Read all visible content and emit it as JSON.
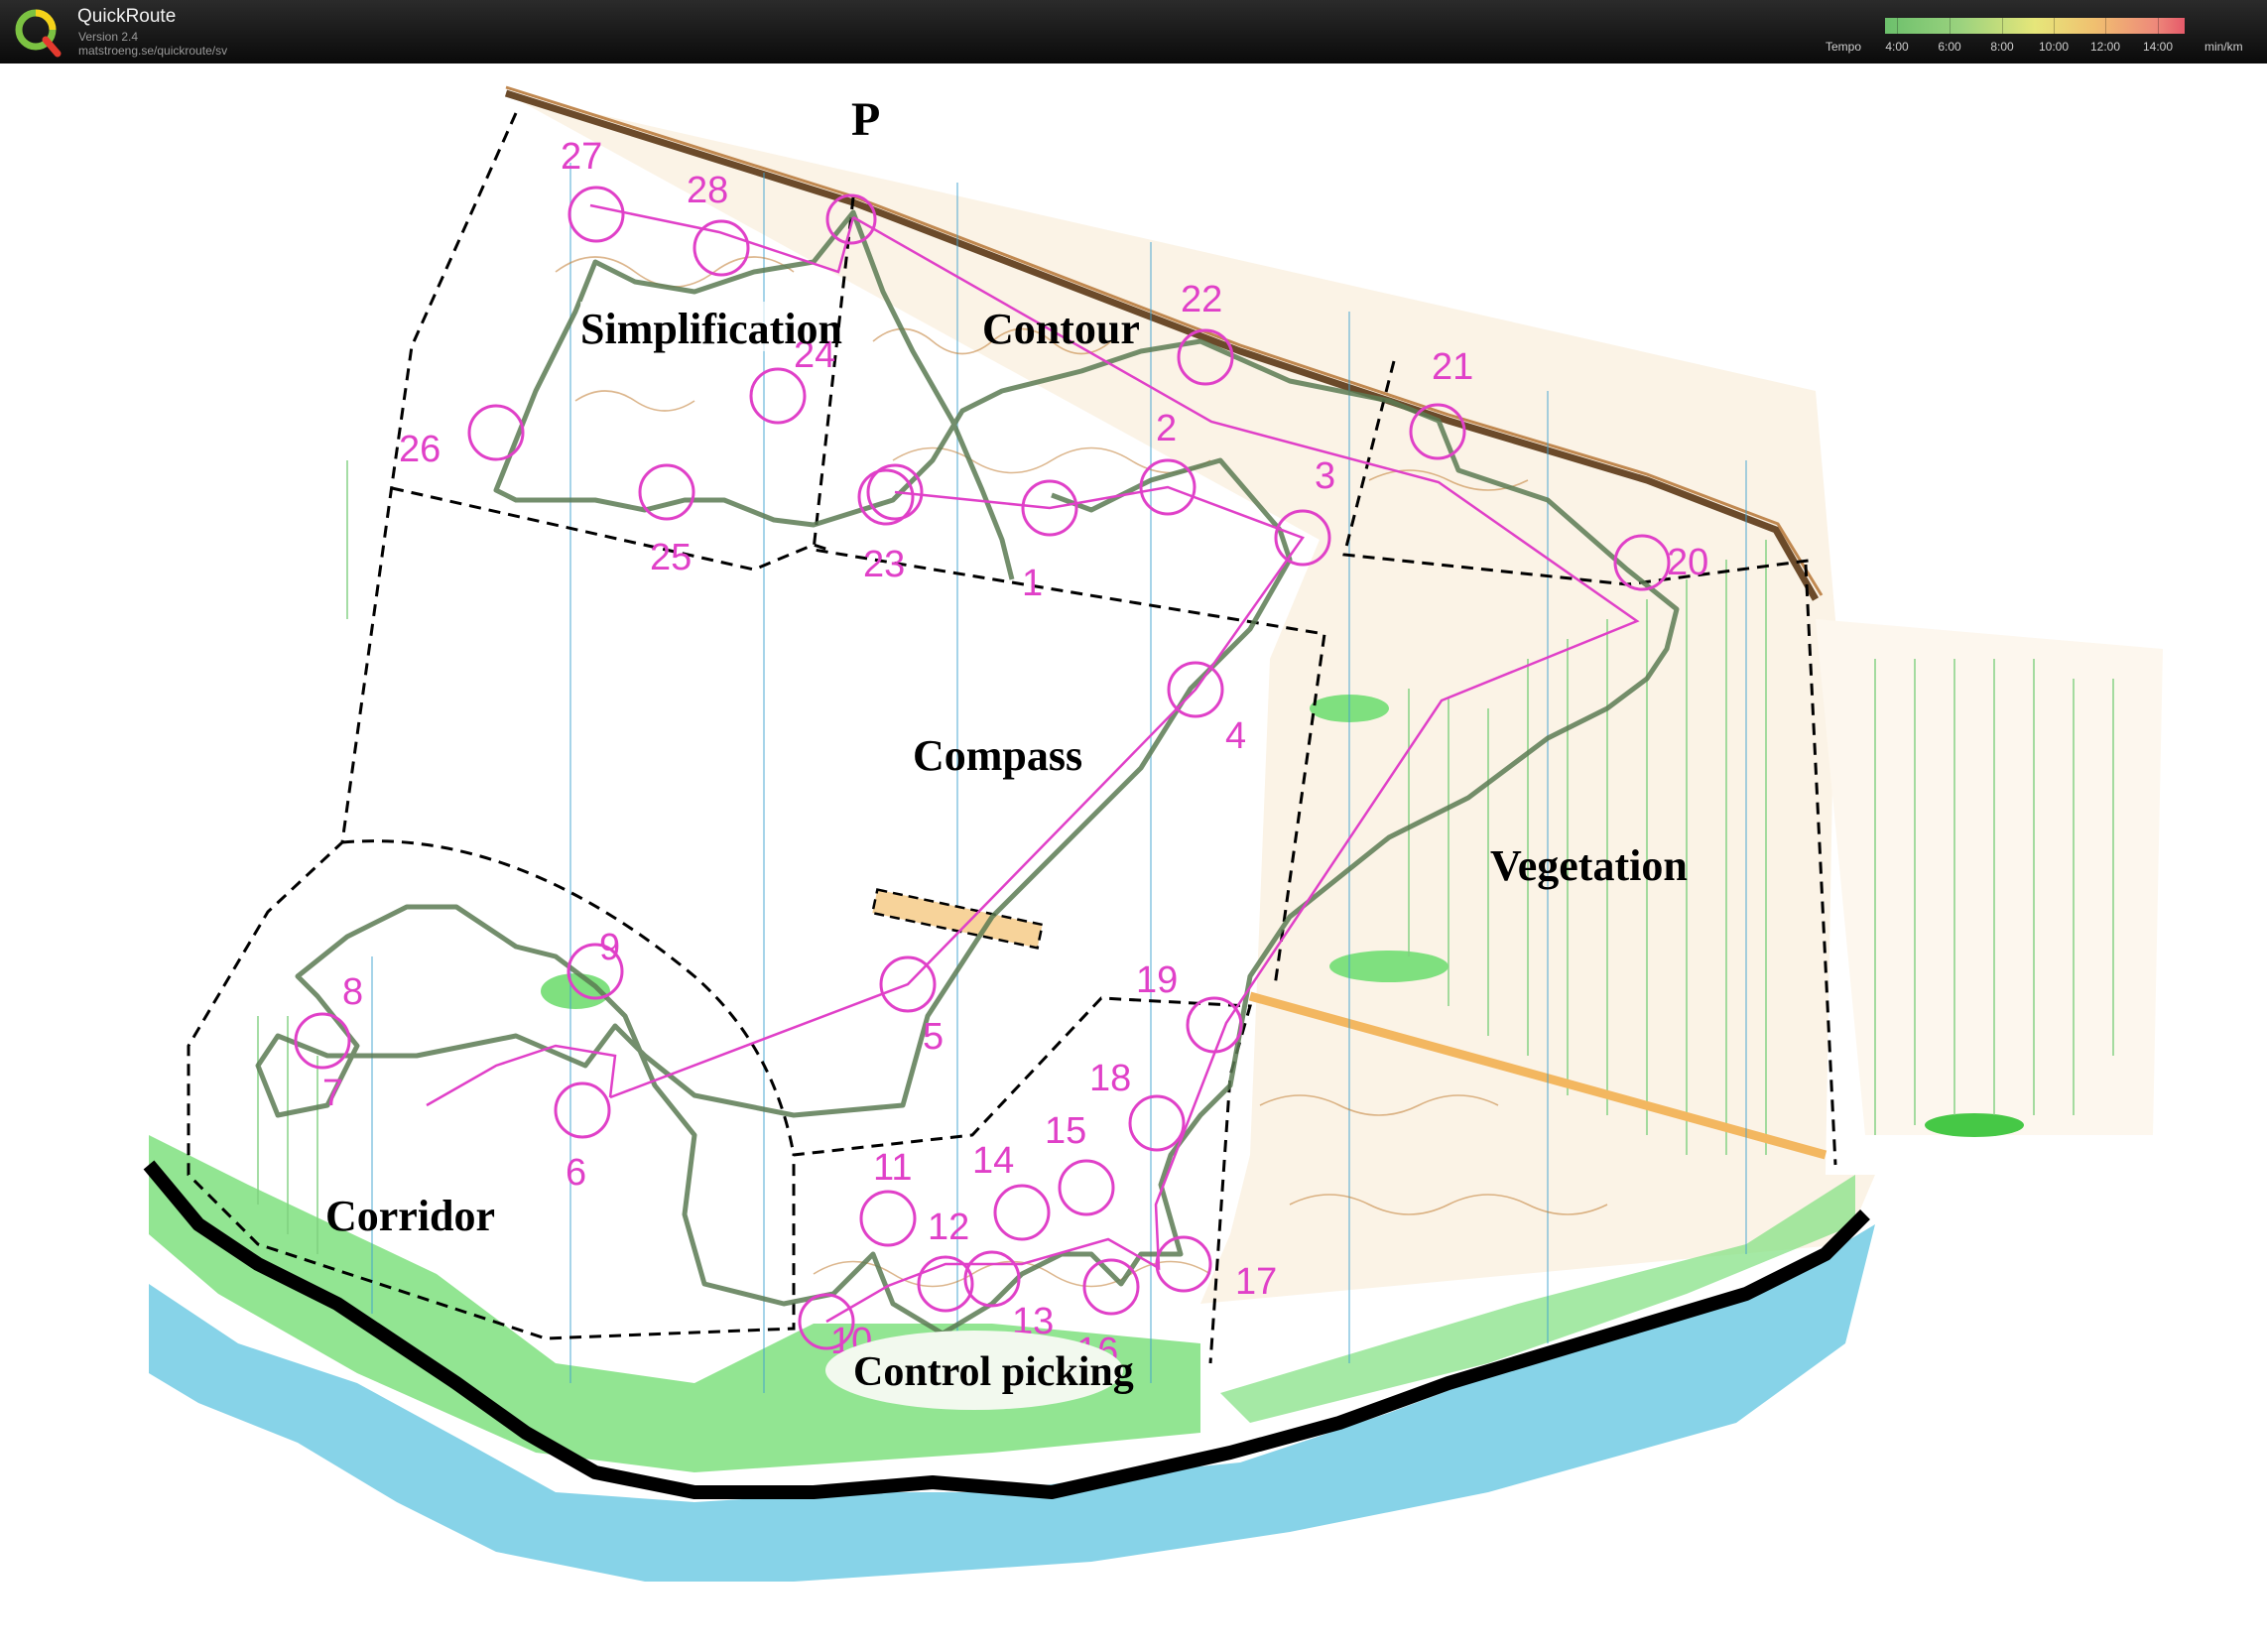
{
  "app": {
    "title": "QuickRoute",
    "version": "Version 2.4",
    "url": "matstroeng.se/quickroute/sv"
  },
  "tempo_scale": {
    "label": "Tempo",
    "unit": "min/km",
    "ticks": [
      "4:00",
      "6:00",
      "8:00",
      "10:00",
      "12:00",
      "14:00"
    ]
  },
  "map": {
    "parking_symbol": "P",
    "areas": [
      "Simplification",
      "Contour",
      "Compass",
      "Vegetation",
      "Corridor",
      "Control picking"
    ],
    "controls": [
      "1",
      "2",
      "3",
      "4",
      "5",
      "6",
      "7",
      "8",
      "9",
      "10",
      "11",
      "12",
      "13",
      "14",
      "15",
      "16",
      "17",
      "18",
      "19",
      "20",
      "21",
      "22",
      "23",
      "24",
      "25",
      "26",
      "27",
      "28"
    ],
    "colors": {
      "course": "#e040c8",
      "route": "#5a7a52",
      "water": "#87d3e8",
      "vegetation": "#46c846",
      "open_land": "#f7d39a",
      "contours": "#b06a28"
    }
  }
}
